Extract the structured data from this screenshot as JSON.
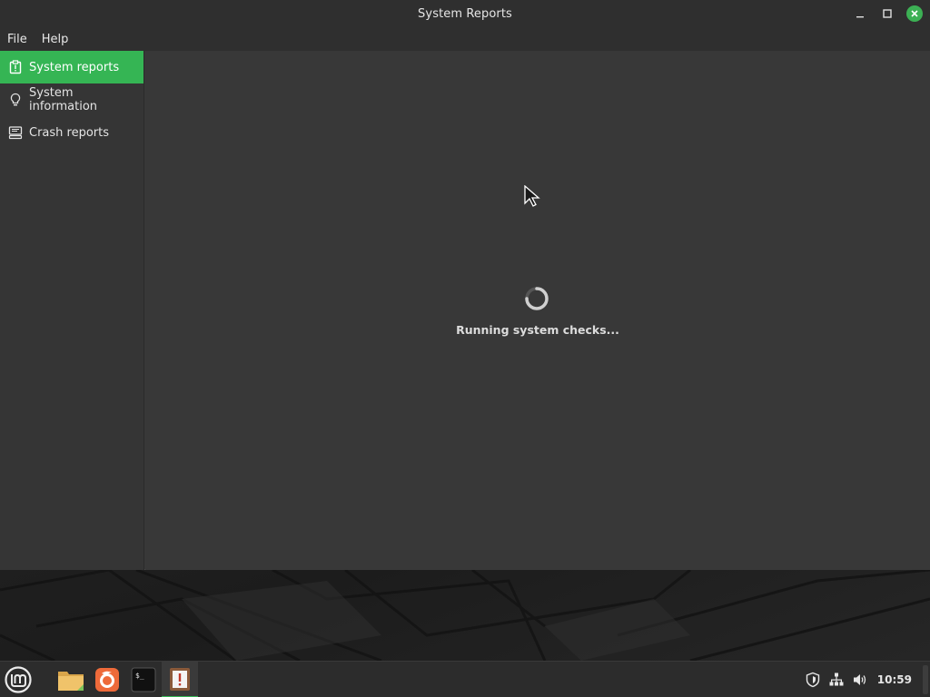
{
  "window": {
    "title": "System Reports"
  },
  "menubar": {
    "items": [
      {
        "label": "File"
      },
      {
        "label": "Help"
      }
    ]
  },
  "sidebar": {
    "items": [
      {
        "label": "System reports",
        "icon": "clipboard-alert-icon",
        "active": true
      },
      {
        "label": "System information",
        "icon": "lightbulb-icon",
        "active": false
      },
      {
        "label": "Crash reports",
        "icon": "monitor-keyboard-icon",
        "active": false
      }
    ]
  },
  "main": {
    "status_text": "Running system checks..."
  },
  "taskbar": {
    "launchers": [
      "files-icon",
      "firefox-icon",
      "terminal-icon",
      "system-reports-icon"
    ],
    "clock": "10:59",
    "tray": [
      "shield-icon",
      "network-icon",
      "volume-icon"
    ]
  },
  "colors": {
    "accent": "#35b554",
    "close_button": "#3cb054",
    "window_bg": "#383838",
    "titlebar_bg": "#2f2f2f"
  }
}
